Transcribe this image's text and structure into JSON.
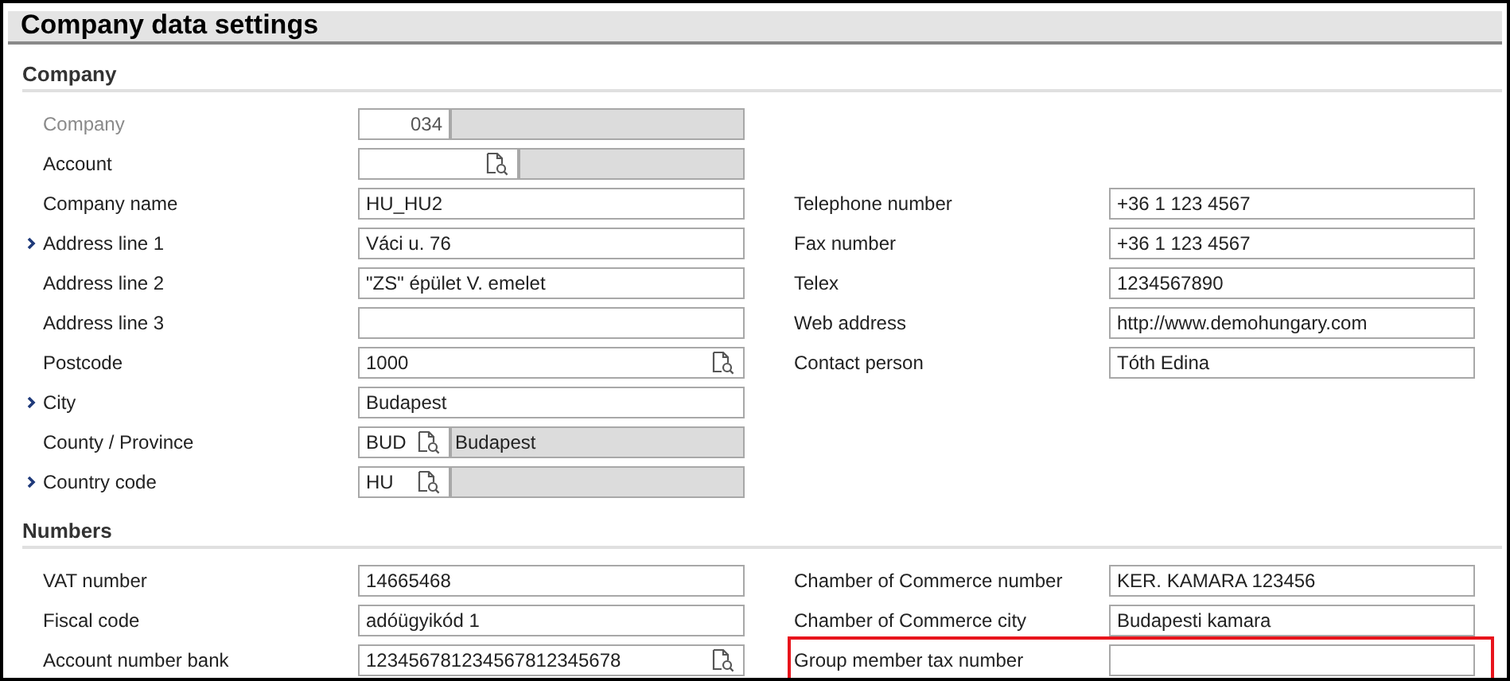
{
  "title": "Company data settings",
  "sections": [
    {
      "heading": "Company",
      "rows": [
        {
          "left": {
            "label": "Company",
            "kind": "code",
            "value": "034",
            "disabled": true,
            "chevron": false
          }
        },
        {
          "left": {
            "label": "Account",
            "kind": "lookup-account",
            "disabled": false,
            "chevron": false
          }
        },
        {
          "left": {
            "label": "Company name",
            "kind": "text",
            "value": "HU_HU2",
            "disabled": false,
            "chevron": false
          },
          "right": {
            "label": "Telephone number",
            "kind": "text",
            "value": "+36 1 123 4567",
            "highlighted": false
          }
        },
        {
          "left": {
            "label": "Address line 1",
            "kind": "text",
            "value": "Váci u. 76",
            "disabled": false,
            "chevron": true
          },
          "right": {
            "label": "Fax number",
            "kind": "text",
            "value": "+36 1 123 4567",
            "highlighted": false
          }
        },
        {
          "left": {
            "label": "Address line 2",
            "kind": "text",
            "value": "\"ZS\" épület V. emelet",
            "disabled": false,
            "chevron": false
          },
          "right": {
            "label": "Telex",
            "kind": "text",
            "value": "1234567890",
            "highlighted": false
          }
        },
        {
          "left": {
            "label": "Address line 3",
            "kind": "text",
            "disabled": false,
            "chevron": false
          },
          "right": {
            "label": "Web address",
            "kind": "text",
            "value": "http://www.demohungary.com",
            "highlighted": false
          }
        },
        {
          "left": {
            "label": "Postcode",
            "kind": "lookup",
            "value": "1000",
            "disabled": false,
            "chevron": false
          },
          "right": {
            "label": "Contact person",
            "kind": "text",
            "value": "Tóth Edina",
            "highlighted": false
          }
        },
        {
          "left": {
            "label": "City",
            "kind": "text",
            "value": "Budapest",
            "disabled": false,
            "chevron": true
          }
        },
        {
          "left": {
            "label": "County / Province",
            "kind": "lookup-code",
            "value": "BUD",
            "description": "Budapest",
            "disabled": false,
            "chevron": false
          }
        },
        {
          "left": {
            "label": "Country code",
            "kind": "lookup-code",
            "value": "HU",
            "disabled": false,
            "chevron": true
          }
        }
      ]
    },
    {
      "heading": "Numbers",
      "rows": [
        {
          "left": {
            "label": "VAT number",
            "kind": "text",
            "value": "14665468",
            "disabled": false,
            "chevron": false
          },
          "right": {
            "label": "Chamber of Commerce number",
            "kind": "text",
            "value": "KER. KAMARA 123456",
            "highlighted": false
          }
        },
        {
          "left": {
            "label": "Fiscal code",
            "kind": "text",
            "value": "adóügyikód 1",
            "disabled": false,
            "chevron": false
          },
          "right": {
            "label": "Chamber of Commerce city",
            "kind": "text",
            "value": "Budapesti kamara",
            "highlighted": false
          }
        },
        {
          "left": {
            "label": "Account number bank",
            "kind": "lookup",
            "value": "123456781234567812345678",
            "disabled": false,
            "chevron": false
          },
          "right": {
            "label": "Group member tax number",
            "kind": "text",
            "highlighted": true
          }
        }
      ]
    }
  ]
}
